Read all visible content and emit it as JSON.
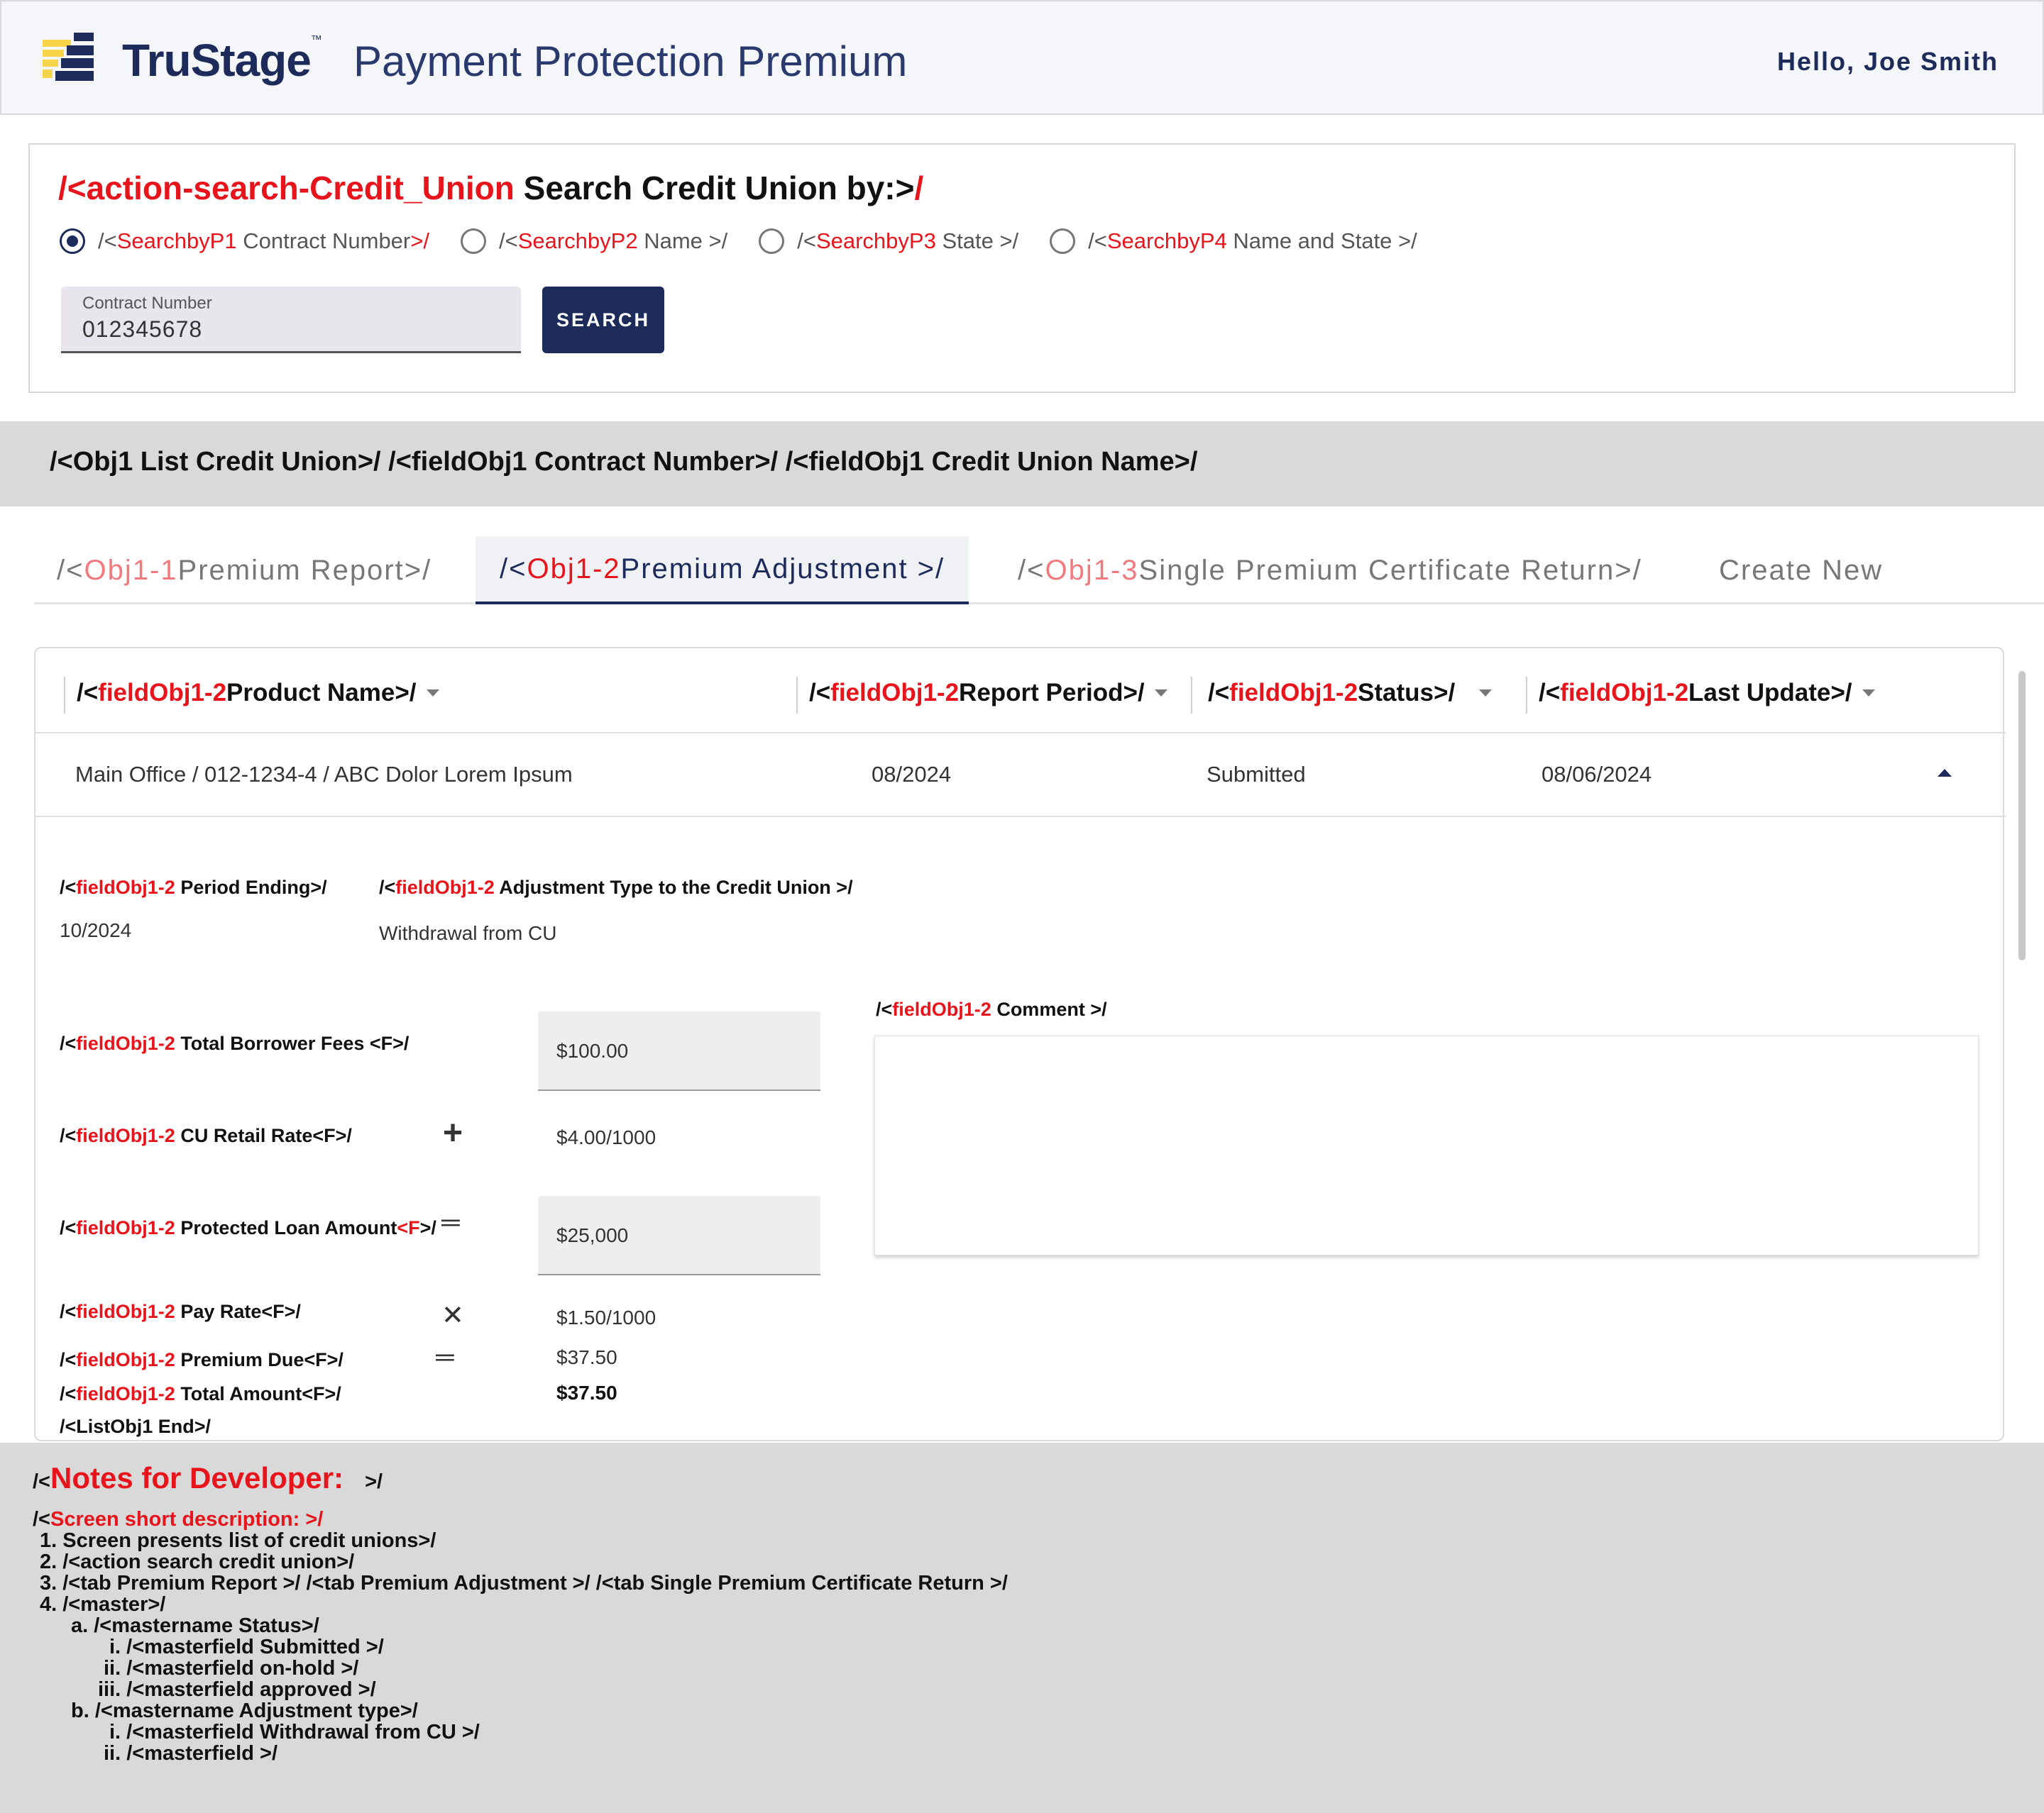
{
  "header": {
    "brand": "TruStage",
    "brand_tm": "™",
    "app_title": "Payment Protection Premium",
    "greeting": "Hello, Joe Smith"
  },
  "search": {
    "title_prefix": "/<action-search-Credit_Union",
    "title_text": " Search Credit Union by:>",
    "title_suffix": "/",
    "radios": [
      {
        "pre": "/<",
        "tag": "SearchbyP1",
        "label": " Contract Number",
        "post": ">/",
        "selected": true
      },
      {
        "pre": "/<",
        "tag": "SearchbyP2",
        "label": " Name >/",
        "post": "",
        "selected": false
      },
      {
        "pre": "/<",
        "tag": "SearchbyP3",
        "label": " State >/",
        "post": "",
        "selected": false
      },
      {
        "pre": "/<",
        "tag": "SearchbyP4",
        "label": " Name and State >/",
        "post": "",
        "selected": false
      }
    ],
    "field_label": "Contract Number",
    "field_value": "012345678",
    "button": "SEARCH"
  },
  "list_band": "/<Obj1 List Credit Union>/ /<fieldObj1 Contract Number>/ /<fieldObj1 Credit Union Name>/",
  "tabs": [
    {
      "pre": "/<",
      "tag": "Obj1-1",
      "label": " Premium Report>/",
      "active": false
    },
    {
      "pre": "/<",
      "tag": "Obj1-2",
      "label": " Premium Adjustment >/",
      "active": true
    },
    {
      "pre": "/<",
      "tag": "Obj1-3",
      "label": " Single Premium Certificate Return>/",
      "active": false
    },
    {
      "pre": "",
      "tag": "",
      "label": "Create New",
      "active": false
    }
  ],
  "table": {
    "headers": [
      {
        "pre": "/<",
        "tag": "fieldObj1-2",
        "label": " Product Name>/"
      },
      {
        "pre": "/<",
        "tag": "fieldObj1-2",
        "label": " Report Period>/"
      },
      {
        "pre": "/<",
        "tag": "fieldObj1-2",
        "label": " Status>/"
      },
      {
        "pre": "/<",
        "tag": "fieldObj1-2",
        "label": " Last Update>/"
      }
    ],
    "row": [
      "Main Office / 012-1234-4 / ABC Dolor Lorem Ipsum",
      "08/2024",
      "Submitted",
      "08/06/2024"
    ]
  },
  "detail": {
    "tag": "fieldObj1-2",
    "period_label": " Period Ending>/",
    "period_value": "10/2024",
    "adj_label": " Adjustment Type to the Credit Union >/",
    "adj_value": "Withdrawal from CU",
    "comment_label": " Comment >/",
    "fees_label": " Total Borrower Fees <F>/",
    "fees_value": "$100.00",
    "retail_label": " CU Retail Rate<F>/",
    "retail_value": "$4.00/1000",
    "loan_label_a": " Protected Loan Amount",
    "loan_label_f": "<F",
    "loan_label_b": ">/",
    "loan_value": "$25,000",
    "pay_label": " Pay Rate<F>/",
    "pay_value": "$1.50/1000",
    "due_label": " Premium Due<F>/",
    "due_value": "$37.50",
    "total_label": " Total Amount<F>/",
    "total_value": "$37.50",
    "list_end": "/<ListObj1 End>/",
    "op_plus": "+",
    "op_eq": "═",
    "op_times": "✕"
  },
  "notes": {
    "title_pre": "/<",
    "title": "Notes for Developer:",
    "title_post": ">/",
    "desc_pre": "/<",
    "desc": "Screen short description: >/",
    "lines": [
      "1.  Screen presents list of credit unions>/",
      "2.  /<action search credit union>/",
      "3.  /<tab Premium Report >/ /<tab Premium Adjustment >/ /<tab Single Premium Certificate Return >/",
      "4.  /<master>/",
      "a.  /<mastername Status>/",
      "i.  /<masterfield Submitted >/",
      "ii.  /<masterfield on-hold >/",
      "iii.  /<masterfield approved >/",
      "b.  /<mastername Adjustment type>/",
      "i.  /<masterfield Withdrawal from CU >/",
      "ii.  /<masterfield >/"
    ]
  },
  "colors": {
    "brand_navy": "#1c2b5a",
    "accent_red": "#e8141b",
    "logo_yellow": "#f7d54a"
  }
}
